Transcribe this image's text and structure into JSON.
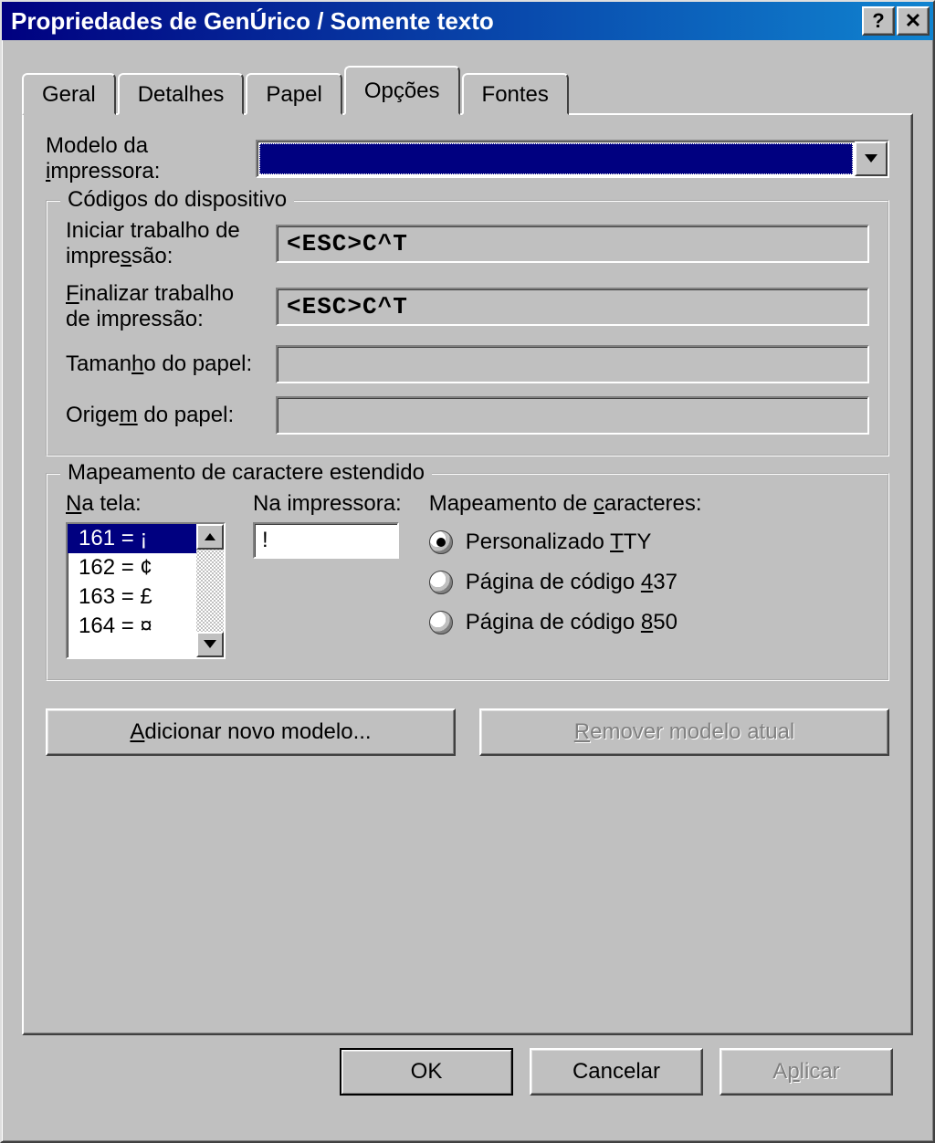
{
  "title": "Propriedades de GenÚrico / Somente texto",
  "tabs": [
    "Geral",
    "Detalhes",
    "Papel",
    "Opções",
    "Fontes"
  ],
  "activeTab": 3,
  "model": {
    "label_a": "Modelo da",
    "label_b": "impressora:",
    "value": ""
  },
  "codes": {
    "legend": "Códigos do dispositivo",
    "start": {
      "label_a": "Iniciar trabalho de",
      "label_b": "impressão:",
      "value": "<ESC>C^T"
    },
    "end": {
      "label_a": "Finalizar trabalho",
      "label_b": "de impressão:",
      "value": "<ESC>C^T"
    },
    "size": {
      "label": "Tamanho do papel:",
      "value": ""
    },
    "source": {
      "label": "Origem do papel:",
      "value": ""
    }
  },
  "ext": {
    "legend": "Mapeamento de caractere estendido",
    "screen_label": "Na tela:",
    "printer_label": "Na impressora:",
    "mapping_label": "Mapeamento de caracteres:",
    "list": [
      "161 = ¡",
      "162 = ¢",
      "163 = £",
      "164 = ¤"
    ],
    "selected_index": 0,
    "printer_value": "!",
    "radios": [
      "Personalizado TTY",
      "Página de código 437",
      "Página de código 850"
    ],
    "radio_selected": 0
  },
  "btns": {
    "add": "Adicionar novo modelo...",
    "remove": "Remover modelo atual",
    "ok": "OK",
    "cancel": "Cancelar",
    "apply": "Aplicar"
  }
}
